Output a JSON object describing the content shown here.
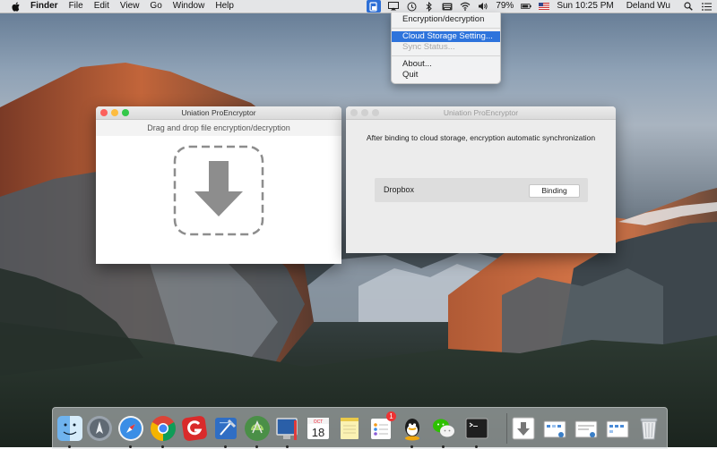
{
  "menubar": {
    "app_name": "Finder",
    "items": [
      "File",
      "Edit",
      "View",
      "Go",
      "Window",
      "Help"
    ],
    "battery": "79%",
    "clock": "Sun 10:25 PM",
    "user": "Deland Wu"
  },
  "dropdown": {
    "items": [
      "Encryption/decryption",
      "Cloud Storage Setting...",
      "Sync Status...",
      "About...",
      "Quit"
    ]
  },
  "windows": {
    "drop": {
      "title": "Uniation ProEncryptor",
      "subtitle": "Drag and drop file encryption/decryption"
    },
    "cloud": {
      "title": "Uniation ProEncryptor",
      "message": "After binding to cloud storage, encryption automatic synchronization",
      "service": "Dropbox",
      "button": "Binding"
    }
  },
  "dock": {
    "calendar_month": "OCT",
    "calendar_day": "18",
    "reminders_badge": "1"
  },
  "colors": {
    "menu_highlight": "#2e74dc",
    "traffic_red": "#fc605c",
    "traffic_yellow": "#fdbc40",
    "traffic_green": "#34c84a",
    "inactive_traffic": "#d0d0d0"
  }
}
